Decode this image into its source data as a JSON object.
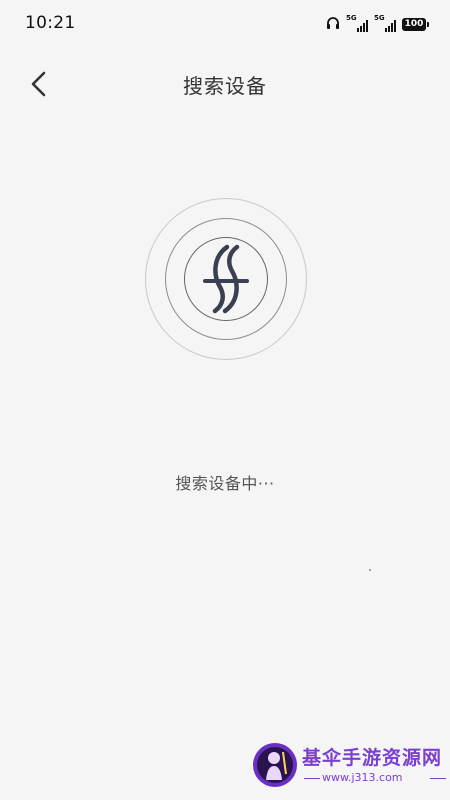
{
  "status_bar": {
    "time": "10:21",
    "sim1_network": "5G",
    "sim2_network": "5G",
    "battery": "100",
    "icons": [
      "headphones-icon",
      "signal-icon",
      "signal-icon",
      "battery-icon"
    ]
  },
  "header": {
    "title": "搜索设备",
    "back_icon": "chevron-left-icon"
  },
  "main": {
    "status_text": "搜索设备中···"
  },
  "watermark": {
    "title": "基伞手游资源网",
    "url": "www.j313.com"
  },
  "colors": {
    "background": "#f5f5f5",
    "text_primary": "#333333",
    "logo": "#3a4052",
    "watermark": "#7b3fd0"
  }
}
